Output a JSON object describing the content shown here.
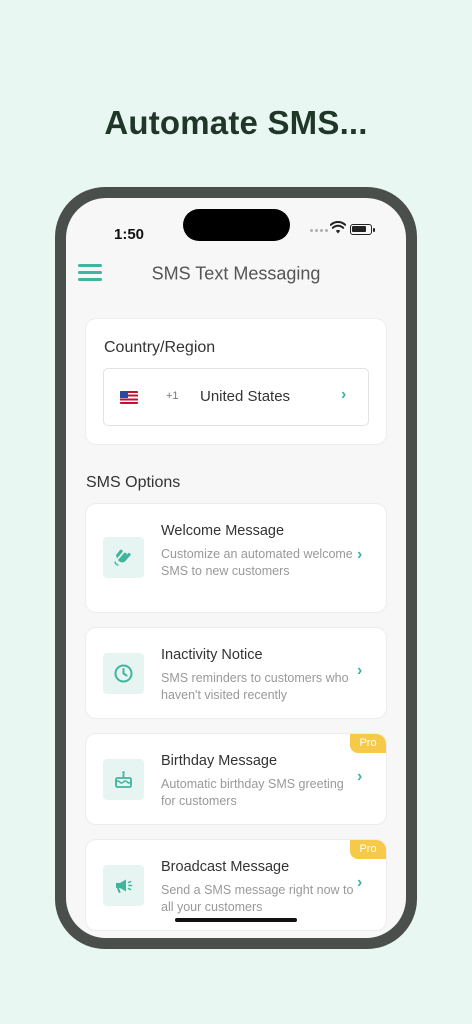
{
  "headline": "Automate SMS...",
  "status_bar": {
    "time": "1:50"
  },
  "header": {
    "title": "SMS Text Messaging"
  },
  "country": {
    "label": "Country/Region",
    "dial_code": "+1",
    "name": "United States"
  },
  "options": {
    "section_title": "SMS Options",
    "items": [
      {
        "title": "Welcome Message",
        "description": "Customize an automated welcome SMS to new customers",
        "icon": "wave-hand-icon"
      },
      {
        "title": "Inactivity Notice",
        "description": "SMS reminders to customers who haven't visited recently",
        "icon": "clock-icon"
      },
      {
        "title": "Birthday Message",
        "description": "Automatic birthday SMS greeting for customers",
        "icon": "cake-icon",
        "badge": "Pro"
      },
      {
        "title": "Broadcast Message",
        "description": "Send a SMS message right now to all your customers",
        "icon": "megaphone-icon",
        "badge": "Pro"
      }
    ]
  },
  "colors": {
    "accent": "#3fb59e",
    "background": "#e9f7f3",
    "headline": "#1f3628",
    "pro_badge": "#f7c948"
  }
}
